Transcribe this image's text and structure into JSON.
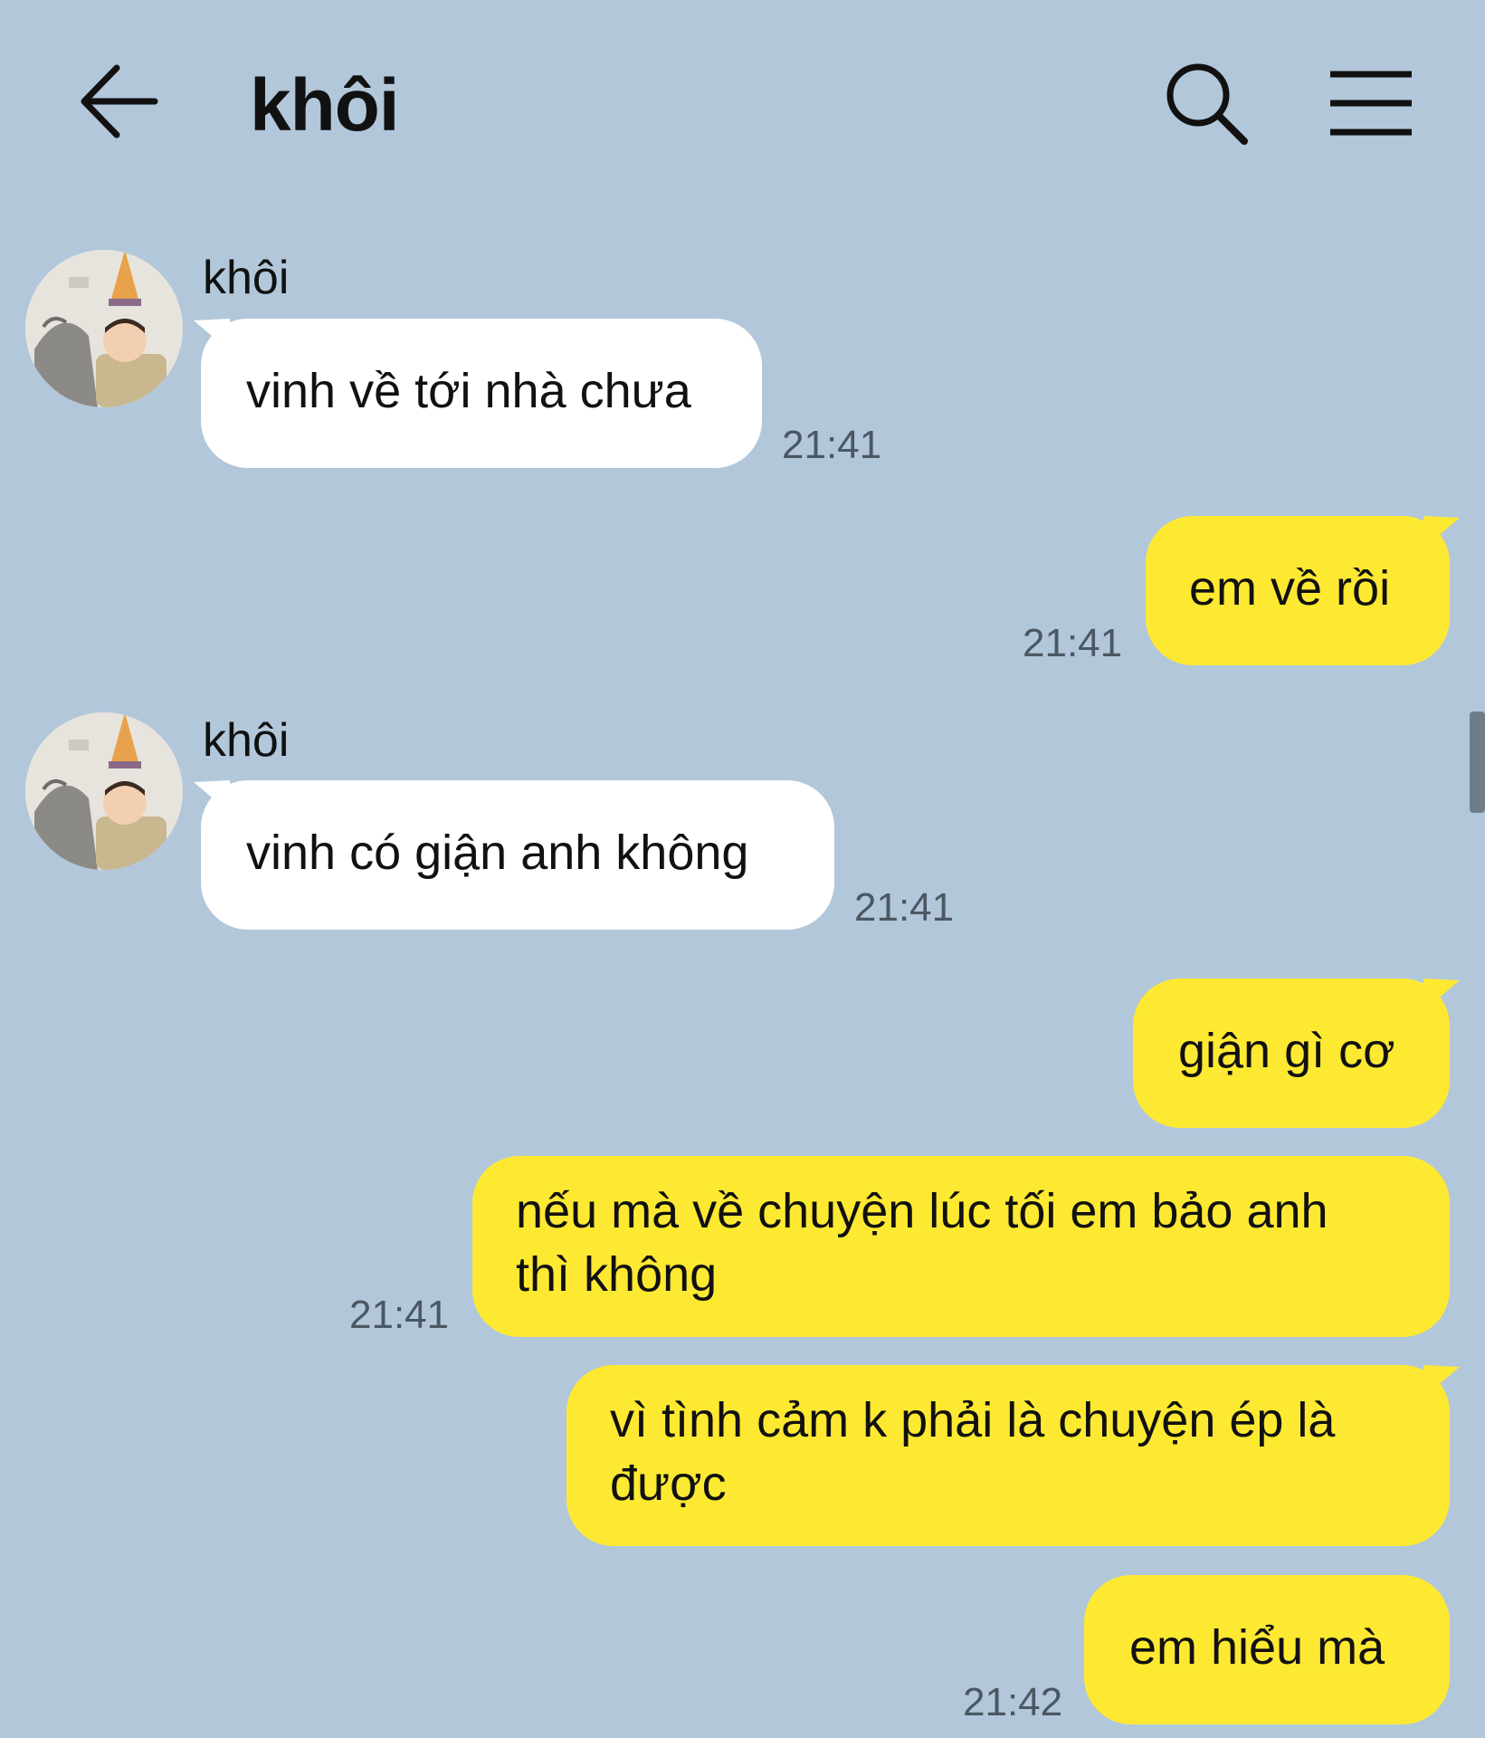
{
  "header": {
    "title": "khôi",
    "back_icon": "arrow-left-icon",
    "search_icon": "search-icon",
    "menu_icon": "hamburger-menu-icon"
  },
  "colors": {
    "background": "#b2c7da",
    "incoming_bubble": "#ffffff",
    "outgoing_bubble": "#fee932",
    "timestamp": "#4b5863"
  },
  "messages": [
    {
      "direction": "incoming",
      "sender": "khôi",
      "text": "vinh về tới nhà chưa",
      "time": "21:41"
    },
    {
      "direction": "outgoing",
      "text": "em về rồi",
      "time": "21:41"
    },
    {
      "direction": "incoming",
      "sender": "khôi",
      "text": "vinh có giận anh không",
      "time": "21:41"
    },
    {
      "direction": "outgoing",
      "text": "giận gì cơ",
      "time": ""
    },
    {
      "direction": "outgoing",
      "lines": [
        "nếu mà về chuyện lúc tối em bảo anh",
        "thì không"
      ],
      "time": "21:41"
    },
    {
      "direction": "outgoing",
      "lines": [
        "vì tình cảm k phải là chuyện ép là",
        "được"
      ],
      "time": ""
    },
    {
      "direction": "outgoing",
      "text": "em hiểu mà",
      "time": "21:42"
    }
  ]
}
